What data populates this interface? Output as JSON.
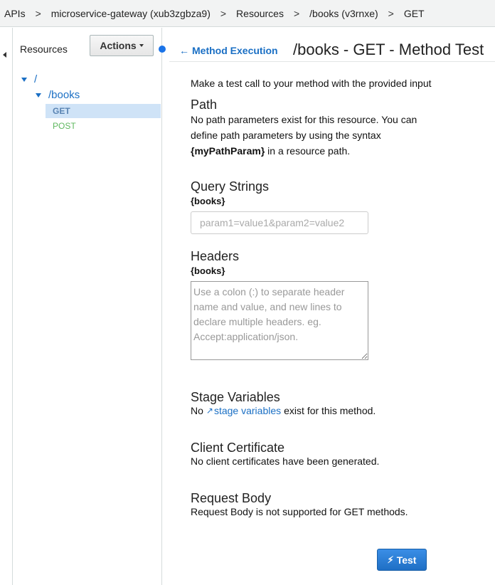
{
  "breadcrumb": {
    "items": [
      "APIs",
      "microservice-gateway (xub3zgbza9)",
      "Resources",
      "/books (v3rnxe)",
      "GET"
    ],
    "separator": ">"
  },
  "sidebar": {
    "title": "Resources",
    "actions_label": "Actions",
    "tree": {
      "root": "/",
      "child": "/books",
      "methods": [
        "GET",
        "POST"
      ],
      "selected_method": "GET"
    }
  },
  "header": {
    "back_label": "Method Execution",
    "title": "/books - GET - Method Test"
  },
  "form": {
    "intro": "Make a test call to your method with the provided input",
    "path": {
      "title": "Path",
      "text_before": "No path parameters exist for this resource. You can define path parameters by using the syntax",
      "syntax": "{myPathParam}",
      "text_after": " in a resource path."
    },
    "query": {
      "title": "Query Strings",
      "tag": "{books}",
      "placeholder": "param1=value1&param2=value2"
    },
    "headers": {
      "title": "Headers",
      "tag": "{books}",
      "placeholder": "Use a colon (:) to separate header name and value, and new lines to declare multiple headers. eg. Accept:application/json."
    },
    "stage": {
      "title": "Stage Variables",
      "prefix": "No",
      "link": "stage variables",
      "suffix": "exist for this method."
    },
    "certificate": {
      "title": "Client Certificate",
      "text": "No client certificates have been generated."
    },
    "body": {
      "title": "Request Body",
      "text": "Request Body is not supported for GET methods."
    },
    "test_label": "Test"
  },
  "colors": {
    "link": "#1a6fc4",
    "selected_bg": "#cfe3f7",
    "get_method": "#5a84b3",
    "post_method": "#5fb85f",
    "primary_button": "#1f6fc5"
  },
  "icons": {
    "back": "arrow-left-icon",
    "external": "external-link-icon",
    "test": "lightning-icon",
    "tree_toggle": "caret-down-icon",
    "collapse": "caret-left-icon"
  }
}
